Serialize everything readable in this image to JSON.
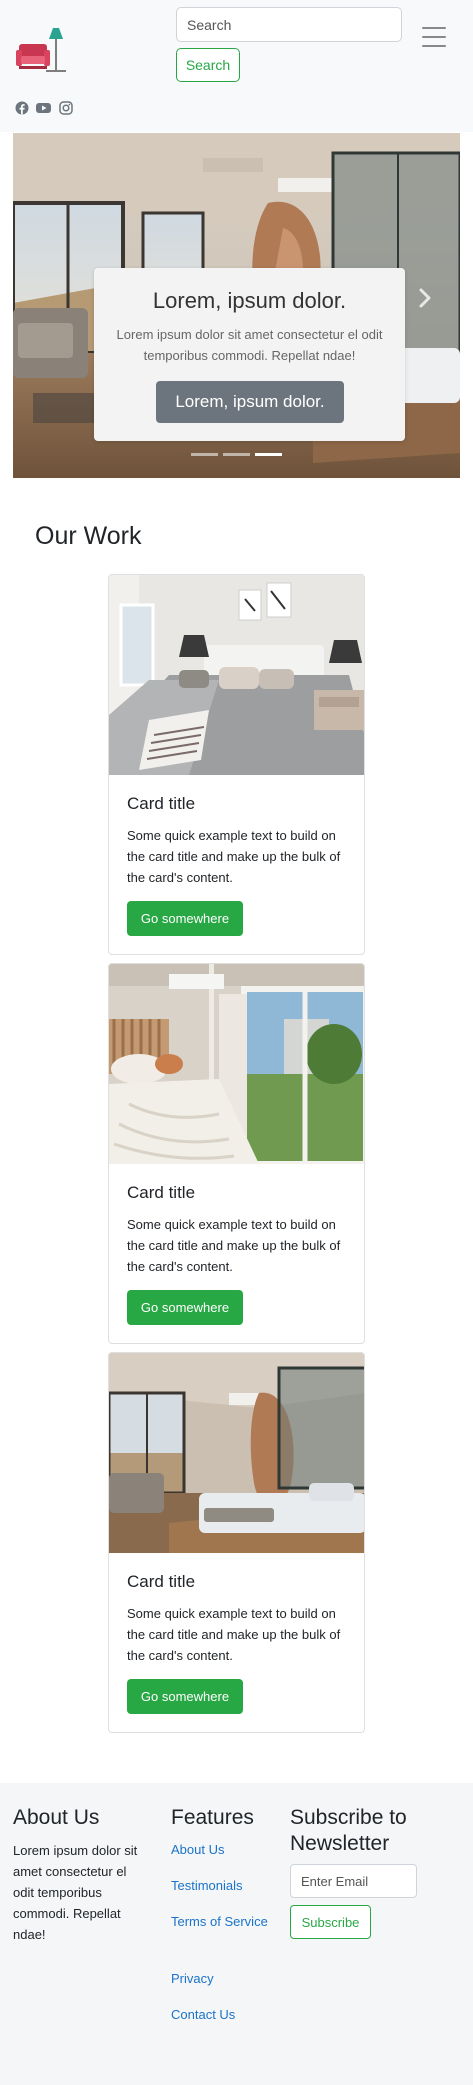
{
  "navbar": {
    "logo_icon": "armchair-lamp-logo",
    "search": {
      "placeholder": "Search",
      "value": ""
    },
    "search_button": "Search",
    "menu_icon": "hamburger-icon",
    "social_icons": [
      "facebook-icon",
      "youtube-icon",
      "instagram-icon"
    ]
  },
  "carousel": {
    "title": "Lorem, ipsum dolor.",
    "text": "Lorem ipsum dolor sit amet consectetur el odit temporibus commodi. Repellat ndae!",
    "button": "Lorem, ipsum dolor.",
    "slide_count": 3,
    "active_slide": 3,
    "next_icon": "chevron-right-icon"
  },
  "work": {
    "title": "Our Work",
    "cards": [
      {
        "title": "Card title",
        "text": "Some quick example text to build on the card title and make up the bulk of the card's content.",
        "button": "Go somewhere"
      },
      {
        "title": "Card title",
        "text": "Some quick example text to build on the card title and make up the bulk of the card's content.",
        "button": "Go somewhere"
      },
      {
        "title": "Card title",
        "text": "Some quick example text to build on the card title and make up the bulk of the card's content.",
        "button": "Go somewhere"
      }
    ]
  },
  "footer": {
    "about": {
      "heading": "About Us",
      "text": "Lorem ipsum dolor sit amet consectetur el odit temporibus commodi. Repellat ndae!"
    },
    "features": {
      "heading": "Features",
      "links": [
        "About Us",
        "Testimonials",
        "Terms of Service",
        "Privacy",
        "Contact Us"
      ]
    },
    "newsletter": {
      "heading": "Subscribe to Newsletter",
      "email_placeholder": "Enter Email",
      "button": "Subscribe"
    }
  },
  "colors": {
    "brand_green": "#28a745",
    "link_blue": "#1a73c9",
    "caption_button": "#6c757d",
    "navbar_bg": "#f8f9fa"
  }
}
